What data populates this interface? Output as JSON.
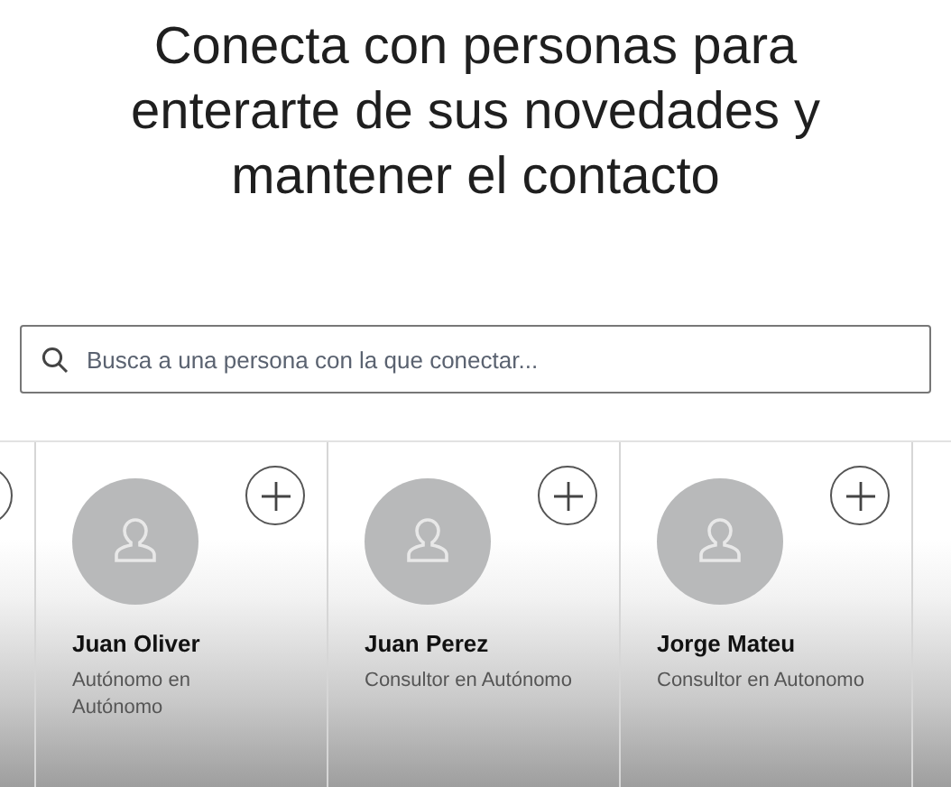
{
  "heading": "Conecta con personas para enterarte de sus novedades y mantener el contacto",
  "search": {
    "placeholder": "Busca a una persona con la que conectar..."
  },
  "cards": [
    {
      "name": "Juan Oliver",
      "subtitle": "Autónomo en Autónomo"
    },
    {
      "name": "Juan Perez",
      "subtitle": "Consultor en Autónomo"
    },
    {
      "name": "Jorge Mateu",
      "subtitle": "Consultor en Autonomo"
    }
  ]
}
